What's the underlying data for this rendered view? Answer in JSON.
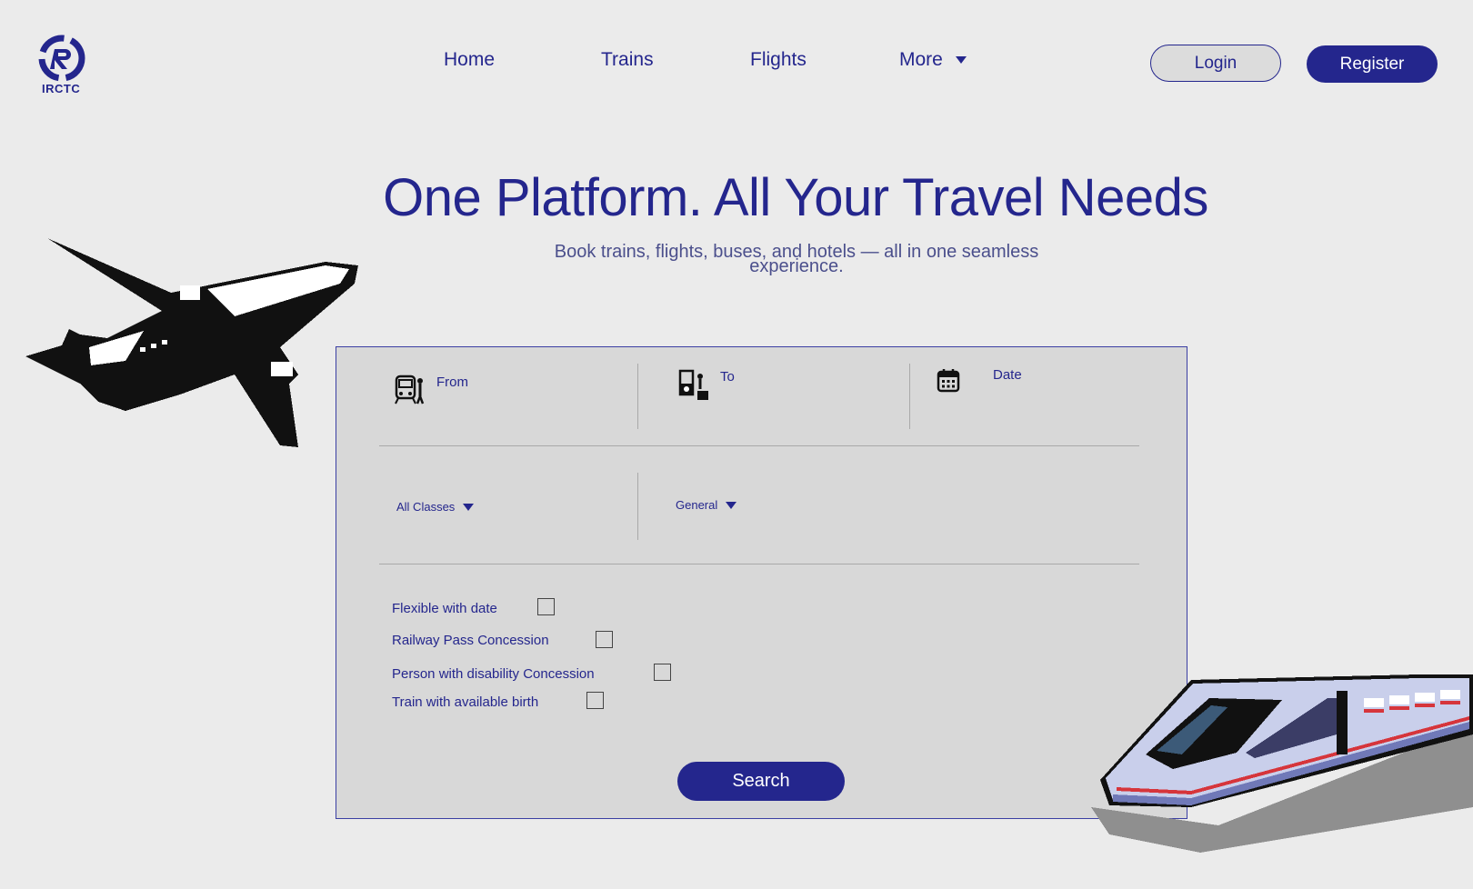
{
  "brand": {
    "logo_text": "IRCTC"
  },
  "nav": {
    "items": [
      {
        "label": "Home"
      },
      {
        "label": "Trains"
      },
      {
        "label": "Flights"
      },
      {
        "label": "More"
      }
    ]
  },
  "auth": {
    "login_label": "Login",
    "register_label": "Register"
  },
  "hero": {
    "title": "One Platform. All Your Travel Needs",
    "subtitle_line1": "Book trains, flights, buses, and hotels — all in one seamless",
    "subtitle_line2": "experience."
  },
  "search_form": {
    "from_label": "From",
    "to_label": "To",
    "date_label": "Date",
    "class_select": "All Classes",
    "quota_select": "General",
    "options": [
      {
        "label": "Flexible with date",
        "checked": false
      },
      {
        "label": "Railway Pass Concession",
        "checked": false
      },
      {
        "label": "Person with disability Concession",
        "checked": false
      },
      {
        "label": "Train with available birth",
        "checked": false
      }
    ],
    "search_label": "Search"
  },
  "colors": {
    "accent": "#24268d",
    "background": "#ebebeb",
    "panel": "#d8d8d8"
  }
}
